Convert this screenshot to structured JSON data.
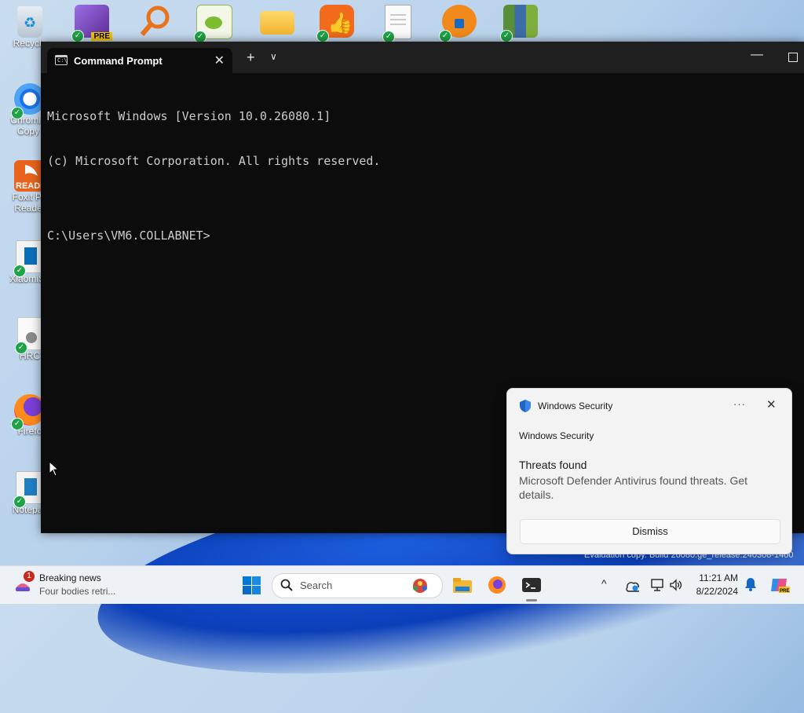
{
  "desktop": {
    "left_icons": [
      {
        "label": "Recycle",
        "icon": "recycle-bin-icon"
      },
      {
        "label": "Chromiu Copy",
        "icon": "chromium-icon"
      },
      {
        "label": "Foxit PI Reade",
        "icon": "foxit-reader-icon"
      },
      {
        "label": "XiaomiSo",
        "icon": "xiaomi-file-icon"
      },
      {
        "label": "HRC",
        "icon": "hrc-file-icon"
      },
      {
        "label": "Firefo",
        "icon": "firefox-icon"
      },
      {
        "label": "Notepac",
        "icon": "notepad-icon"
      }
    ],
    "top_icons": [
      "visual-studio-preview-icon",
      "search-tool-icon",
      "notepad-plus-icon",
      "folder-icon",
      "thumbs-up-app-icon",
      "document-icon",
      "lock-app-icon",
      "books-app-icon"
    ],
    "top_icon_badge": "PRE"
  },
  "terminal": {
    "tab_title": "Command Prompt",
    "tab_icon_text": "C:\\",
    "console_lines": [
      "Microsoft Windows [Version 10.0.26080.1]",
      "(c) Microsoft Corporation. All rights reserved.",
      "",
      "C:\\Users\\VM6.COLLABNET>"
    ]
  },
  "toast": {
    "app_name": "Windows Security",
    "sender": "Windows Security",
    "title": "Threats found",
    "body": "Microsoft Defender Antivirus found threats. Get details.",
    "dismiss_label": "Dismiss",
    "more_label": "···",
    "close_label": "✕"
  },
  "watermark": "Evaluation copy. Build 26080.ge_release.240308-1400",
  "taskbar": {
    "news_badge": "1",
    "news_title": "Breaking news",
    "news_subtitle": "Four bodies retri...",
    "search_placeholder": "Search",
    "clock_time": "11:21 AM",
    "clock_date": "8/22/2024",
    "tray_chevron": "^"
  },
  "colors": {
    "terminal_bg": "#0c0c0c",
    "titlebar_bg": "#1f1f1f",
    "toast_bg": "#f3f3f3",
    "taskbar_bg": "#eef1f6",
    "windows_blue": "#0078d4"
  }
}
